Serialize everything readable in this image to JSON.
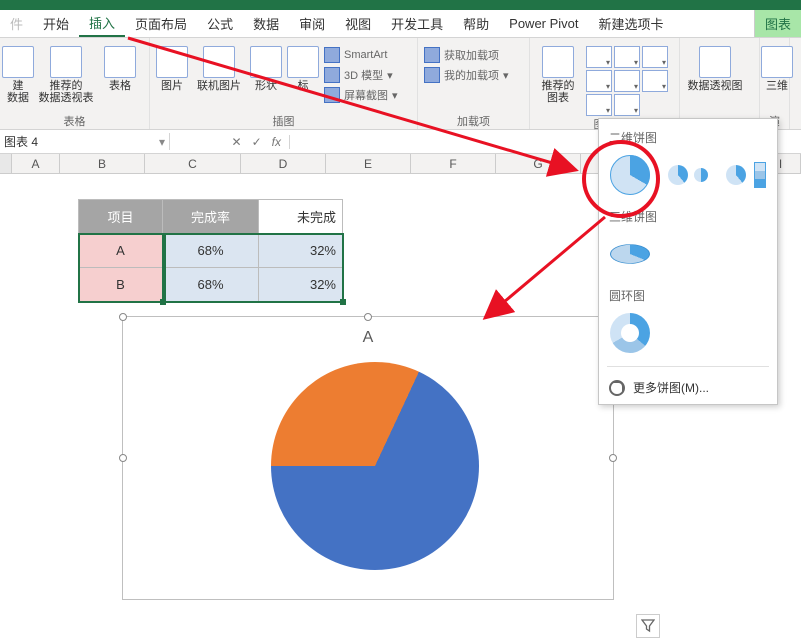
{
  "tabs": {
    "t0": "件",
    "t1": "开始",
    "t2": "插入",
    "t3": "页面布局",
    "t4": "公式",
    "t5": "数据",
    "t6": "审阅",
    "t7": "视图",
    "t8": "开发工具",
    "t9": "帮助",
    "t10": "Power Pivot",
    "t11": "新建选项卡",
    "t12": "图表",
    "t13": "演"
  },
  "ribbon": {
    "pivot1": "建",
    "pivot1b": "数据",
    "pivot2": "推荐的\n数据透视表",
    "pivot3": "表格",
    "grp_tables": "表格",
    "pic": "图片",
    "opic": "联机图片",
    "shapes": "形状",
    "icons": "标",
    "smartart": "SmartArt",
    "threed": "3D 模型",
    "screenshot": "屏幕截图",
    "grp_illus": "插图",
    "getaddin": "获取加载项",
    "myaddin": "我的加载项",
    "grp_addin": "加载项",
    "reccharts": "推荐的\n图表",
    "grp_charts": "图表",
    "pvtchart": "数据透视图",
    "threedm": "三维"
  },
  "fx": {
    "name": "图表 4",
    "x": "✕",
    "v": "✓",
    "fx": "fx"
  },
  "cols": {
    "A": "A",
    "B": "B",
    "C": "C",
    "D": "D",
    "E": "E",
    "F": "F",
    "G": "G",
    "I": "I"
  },
  "table": {
    "h1": "项目",
    "h2": "完成率",
    "h3": "未完成",
    "r1c1": "A",
    "r1c2": "68%",
    "r1c3": "32%",
    "r2c1": "B",
    "r2c2": "68%",
    "r2c3": "32%"
  },
  "dropdown": {
    "sec1": "二维饼图",
    "sec2": "三维饼图",
    "sec3": "圆环图",
    "more": "更多饼图(M)..."
  },
  "chart": {
    "title": "A"
  },
  "chart_data": {
    "type": "pie",
    "title": "A",
    "categories": [
      "完成率",
      "未完成"
    ],
    "values": [
      68,
      32
    ],
    "series": [
      {
        "name": "A",
        "values": [
          68,
          32
        ]
      }
    ],
    "colors": [
      "#4472c4",
      "#ed7d31"
    ]
  }
}
